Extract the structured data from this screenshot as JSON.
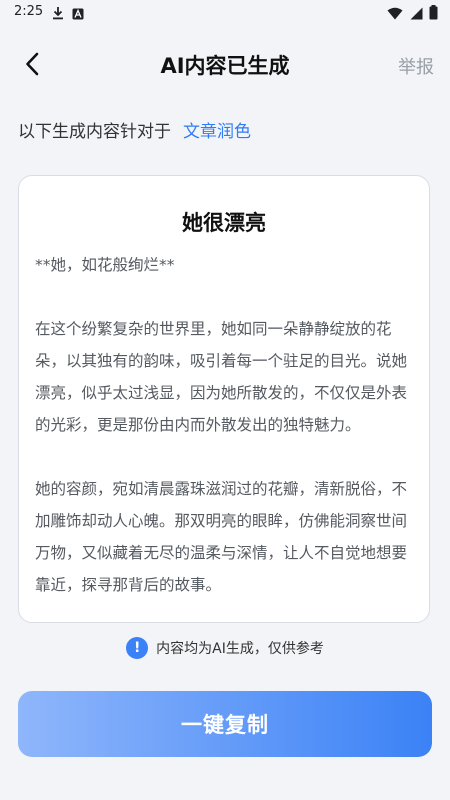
{
  "status_bar": {
    "time": "2:25",
    "icons": [
      "download-icon",
      "a-icon",
      "wifi-icon",
      "signal-icon",
      "battery-icon"
    ]
  },
  "header": {
    "title": "AI内容已生成",
    "report_label": "举报",
    "back_icon": "chevron-left-icon"
  },
  "context": {
    "prefix": "以下生成内容针对于",
    "type_label": "文章润色"
  },
  "article": {
    "title": "她很漂亮",
    "paragraphs": [
      "**她，如花般绚烂**",
      "在这个纷繁复杂的世界里，她如同一朵静静绽放的花朵，以其独有的韵味，吸引着每一个驻足的目光。说她漂亮，似乎太过浅显，因为她所散发的，不仅仅是外表的光彩，更是那份由内而外散发出的独特魅力。",
      "她的容颜，宛如清晨露珠滋润过的花瓣，清新脱俗，不加雕饰却动人心魄。那双明亮的眼眸，仿佛能洞察世间万物，又似藏着无尽的温柔与深情，让人不自觉地想要靠近，探寻那背后的故事。"
    ]
  },
  "disclaimer": {
    "icon": "info-icon",
    "text": "内容均为AI生成，仅供参考"
  },
  "actions": {
    "copy_label": "一键复制"
  },
  "colors": {
    "accent": "#2f7cf6",
    "button_gradient_start": "#8fb6fb",
    "button_gradient_end": "#3b82f6",
    "background": "#f2f4f8"
  }
}
